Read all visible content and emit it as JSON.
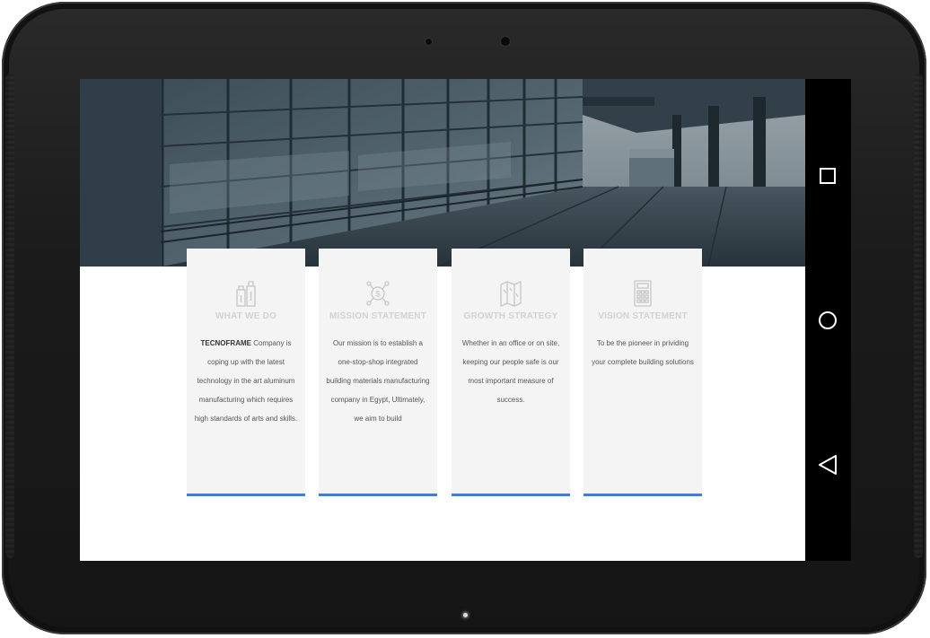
{
  "cards": [
    {
      "icon": "bottles-icon",
      "title": "WHAT WE DO",
      "body_bold": "TECNOFRAME",
      "body": " Company is coping up with the latest technology in the art aluminum manufacturing which requires high standards of arts and skills."
    },
    {
      "icon": "dollar-network-icon",
      "title": "MISSION STATEMENT",
      "body_bold": "",
      "body": "Our mission is to establish a one-stop-shop integrated building materials manufacturing company in Egypt, Ultimately, we aim to build"
    },
    {
      "icon": "folded-map-icon",
      "title": "GROWTH STRATEGY",
      "body_bold": "",
      "body": "Whether in an office or on site, keeping our people safe is our most important measure of success."
    },
    {
      "icon": "calculator-icon",
      "title": "VISION STATEMENT",
      "body_bold": "",
      "body": "To be the pioneer in prividing your complete  building solutions"
    }
  ],
  "colors": {
    "accent": "#3e7ed8",
    "card_bg": "#f4f4f4",
    "title": "#d2d2d2"
  }
}
